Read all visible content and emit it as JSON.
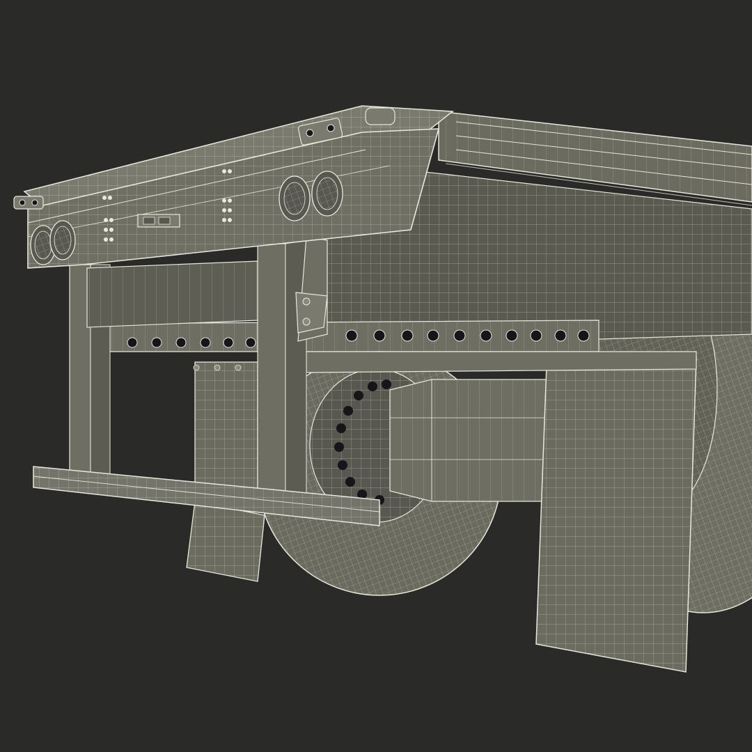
{
  "scene": {
    "background": "#2a2a29",
    "surface_color": "#6e6e62",
    "surface_dark": "#4b4b43",
    "surface_light": "#8a8a7c",
    "wire_color": "#e9e8dc",
    "hole_color": "#15151a"
  }
}
